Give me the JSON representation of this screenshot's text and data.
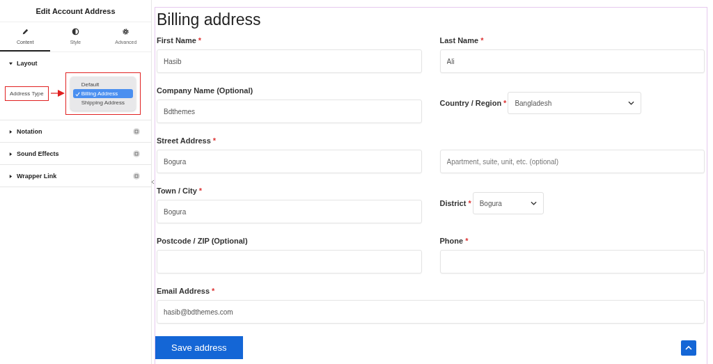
{
  "panel": {
    "title": "Edit Account Address",
    "tabs": [
      {
        "label": "Content",
        "selected": true
      },
      {
        "label": "Style",
        "selected": false
      },
      {
        "label": "Advanced",
        "selected": false
      }
    ],
    "sections": [
      {
        "title": "Layout",
        "expanded": true,
        "control": {
          "label": "Address Type",
          "options": [
            {
              "label": "Default",
              "selected": false
            },
            {
              "label": "Billing Address",
              "selected": true
            },
            {
              "label": "Shipping Address",
              "selected": false
            }
          ]
        }
      },
      {
        "title": "Notation",
        "expanded": false
      },
      {
        "title": "Sound Effects",
        "expanded": false
      },
      {
        "title": "Wrapper Link",
        "expanded": false
      }
    ]
  },
  "form": {
    "title": "Billing address",
    "fields": [
      {
        "kind": "input",
        "label": "First Name",
        "required_mark": "*",
        "value": "Hasib"
      },
      {
        "kind": "input",
        "label": "Last Name",
        "required_mark": "*",
        "value": "Ali"
      },
      {
        "kind": "input",
        "label": "Company Name (Optional)",
        "value": "Bdthemes"
      },
      {
        "kind": "select",
        "label": "Country / Region",
        "required_mark": "*",
        "value": "Bangladesh"
      },
      {
        "kind": "input",
        "label": "Street Address",
        "required_mark": "*",
        "value": "Bogura"
      },
      {
        "kind": "input",
        "placeholder": "Apartment, suite, unit, etc. (optional)"
      },
      {
        "kind": "input",
        "label": "Town / City",
        "required_mark": "*",
        "value": "Bogura"
      },
      {
        "kind": "select",
        "label": "District",
        "required_mark": "*",
        "value": "Bogura"
      },
      {
        "kind": "input",
        "label": "Postcode / ZIP (Optional)"
      },
      {
        "kind": "input",
        "label": "Phone",
        "required_mark": "*"
      },
      {
        "kind": "input",
        "label": "Email Address",
        "required_mark": "*",
        "value": "hasib@bdthemes.com",
        "wide": true
      }
    ],
    "submit": "Save address"
  }
}
